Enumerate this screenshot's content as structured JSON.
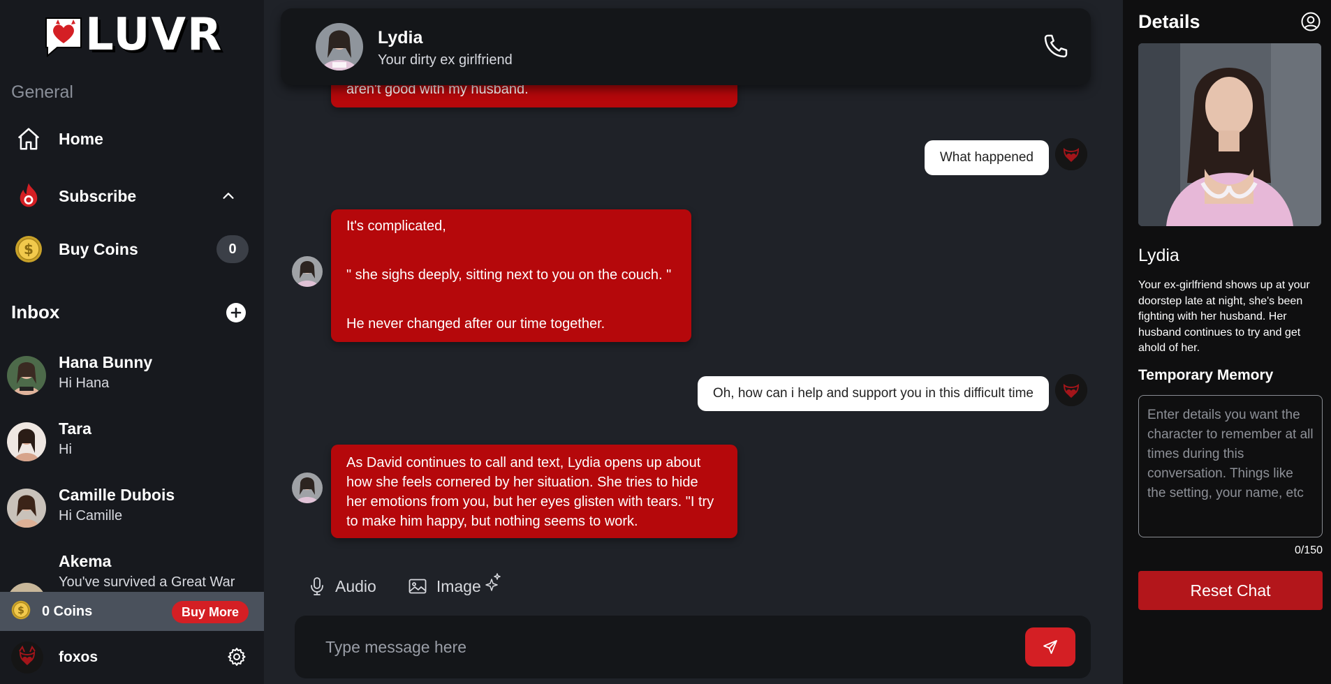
{
  "brand": {
    "logo_text": "LUVR",
    "accent": "#d41f24",
    "bubble_color": "#b5080b"
  },
  "sidebar": {
    "general_label": "General",
    "nav": [
      {
        "label": "Home",
        "icon": "home-icon"
      },
      {
        "label": "Subscribe",
        "icon": "flame-icon"
      },
      {
        "label": "Buy Coins",
        "icon": "coin-icon",
        "badge": "0"
      }
    ],
    "inbox_label": "Inbox",
    "chats": [
      {
        "name": "Hana Bunny",
        "last": "Hi Hana"
      },
      {
        "name": "Tara",
        "last": "Hi"
      },
      {
        "name": "Camille Dubois",
        "last": "Hi Camille"
      },
      {
        "name": "Akema",
        "last": "You've survived a Great War"
      }
    ],
    "coins_text": "0 Coins",
    "buy_more": "Buy More",
    "username": "foxos"
  },
  "chat": {
    "name": "Lydia",
    "subtitle": "Your dirty ex girlfriend",
    "messages": [
      {
        "from": "ai",
        "text": "aren't good with my husband."
      },
      {
        "from": "user",
        "text": "What happened"
      },
      {
        "from": "ai",
        "lines": [
          "It's complicated,",
          "\" she sighs deeply, sitting next to you on the couch. \"",
          "He never changed after our time together."
        ]
      },
      {
        "from": "user",
        "text": "Oh, how can i help and support you in this difficult time"
      },
      {
        "from": "ai",
        "text": "As David continues to call and text, Lydia opens up about how she feels cornered by her situation. She tries to hide her emotions from you, but her eyes glisten with tears. \"I try to make him happy, but nothing seems to work."
      }
    ],
    "audio_label": "Audio",
    "image_label": "Image",
    "input_placeholder": "Type message here"
  },
  "details": {
    "title": "Details",
    "name": "Lydia",
    "description": "Your ex-girlfriend shows up at your doorstep late at night, she's been fighting with her husband. Her husband continues to try and get ahold of her.",
    "memory_title": "Temporary Memory",
    "memory_placeholder": "Enter details you want the character to remember at all times during this conversation. Things like the setting, your name, etc",
    "memory_count": "0/150",
    "reset_label": "Reset Chat"
  }
}
